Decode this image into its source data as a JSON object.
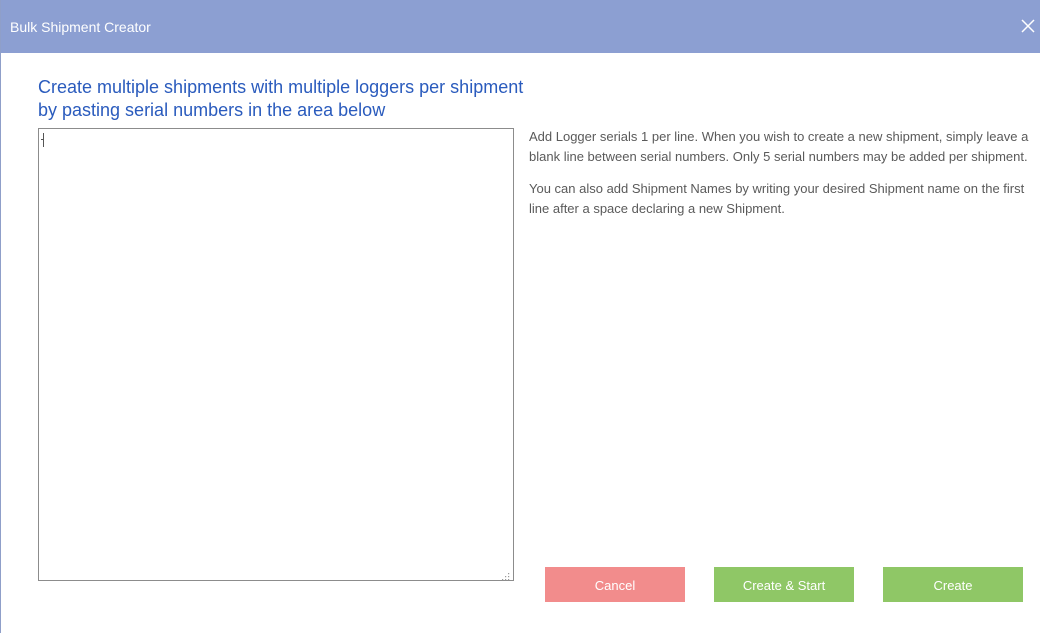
{
  "window": {
    "title": "Bulk Shipment Creator",
    "close_icon": "close-icon",
    "titlebar_color": "#8c9fd2"
  },
  "main": {
    "heading": "Create multiple shipments with multiple loggers per shipment by pasting serial numbers in the area below",
    "serials_input": {
      "value": "",
      "placeholder": ""
    },
    "help": [
      "Add Logger serials 1 per line. When you wish to create a new shipment, simply leave a blank line between serial numbers. Only 5 serial numbers may be added per shipment.",
      "You can also add Shipment Names by writing your desired Shipment name on the first line after a space declaring a new Shipment."
    ]
  },
  "actions": {
    "cancel_label": "Cancel",
    "create_start_label": "Create & Start",
    "create_label": "Create",
    "cancel_color": "#f28c8c",
    "create_color": "#8fc766"
  }
}
